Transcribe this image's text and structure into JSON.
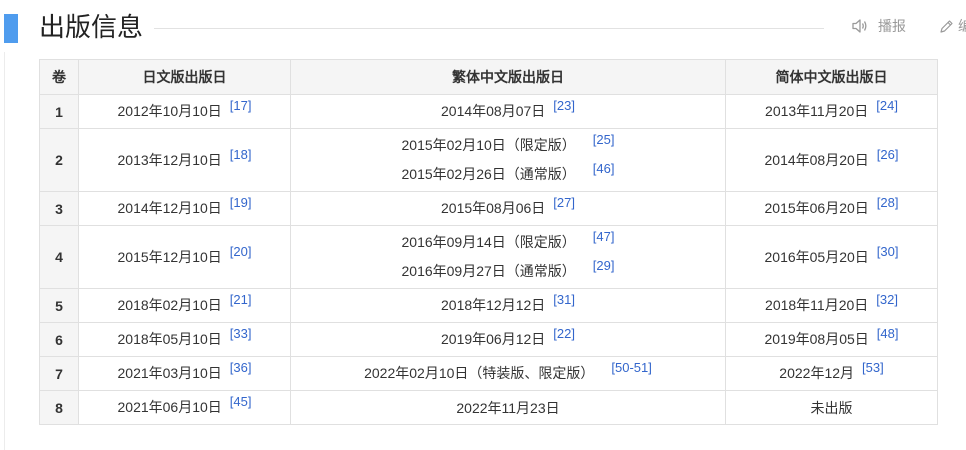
{
  "header": {
    "title": "出版信息",
    "play_label": "播报",
    "edit_label": "编",
    "accent_color": "#4f9cee",
    "play_icon": "speaker-icon",
    "edit_icon": "pencil-icon"
  },
  "table": {
    "headers": [
      "卷",
      "日文版出版日",
      "繁体中文版出版日",
      "简体中文版出版日"
    ],
    "link_color": "#3366cc",
    "rows": [
      {
        "vol": "1",
        "jp": {
          "date": "2012年10月10日",
          "ref": "[17]"
        },
        "tw": [
          {
            "date": "2014年08月07日",
            "ref": "[23]"
          }
        ],
        "cn": {
          "date": "2013年11月20日",
          "ref": "[24]"
        }
      },
      {
        "vol": "2",
        "jp": {
          "date": "2013年12月10日",
          "ref": "[18]"
        },
        "tw": [
          {
            "date": "2015年02月10日（限定版）",
            "ref": "[25]"
          },
          {
            "date": "2015年02月26日（通常版）",
            "ref": "[46]"
          }
        ],
        "cn": {
          "date": "2014年08月20日",
          "ref": "[26]"
        }
      },
      {
        "vol": "3",
        "jp": {
          "date": "2014年12月10日",
          "ref": "[19]"
        },
        "tw": [
          {
            "date": "2015年08月06日",
            "ref": "[27]"
          }
        ],
        "cn": {
          "date": "2015年06月20日",
          "ref": "[28]"
        }
      },
      {
        "vol": "4",
        "jp": {
          "date": "2015年12月10日",
          "ref": "[20]"
        },
        "tw": [
          {
            "date": "2016年09月14日（限定版）",
            "ref": "[47]"
          },
          {
            "date": "2016年09月27日（通常版）",
            "ref": "[29]"
          }
        ],
        "cn": {
          "date": "2016年05月20日",
          "ref": "[30]"
        }
      },
      {
        "vol": "5",
        "jp": {
          "date": "2018年02月10日",
          "ref": "[21]"
        },
        "tw": [
          {
            "date": "2018年12月12日",
            "ref": "[31]"
          }
        ],
        "cn": {
          "date": "2018年11月20日",
          "ref": "[32]"
        }
      },
      {
        "vol": "6",
        "jp": {
          "date": "2018年05月10日",
          "ref": "[33]"
        },
        "tw": [
          {
            "date": "2019年06月12日",
            "ref": "[22]"
          }
        ],
        "cn": {
          "date": "2019年08月05日",
          "ref": "[48]"
        }
      },
      {
        "vol": "7",
        "jp": {
          "date": "2021年03月10日",
          "ref": "[36]"
        },
        "tw": [
          {
            "date": "2022年02月10日（特装版、限定版）",
            "ref": "[50-51]"
          }
        ],
        "cn": {
          "date": "2022年12月",
          "ref": "[53]"
        }
      },
      {
        "vol": "8",
        "jp": {
          "date": "2021年06月10日",
          "ref": "[45]"
        },
        "tw": [
          {
            "date": "2022年11月23日",
            "ref": ""
          }
        ],
        "cn": {
          "date": "未出版",
          "ref": ""
        }
      }
    ]
  }
}
